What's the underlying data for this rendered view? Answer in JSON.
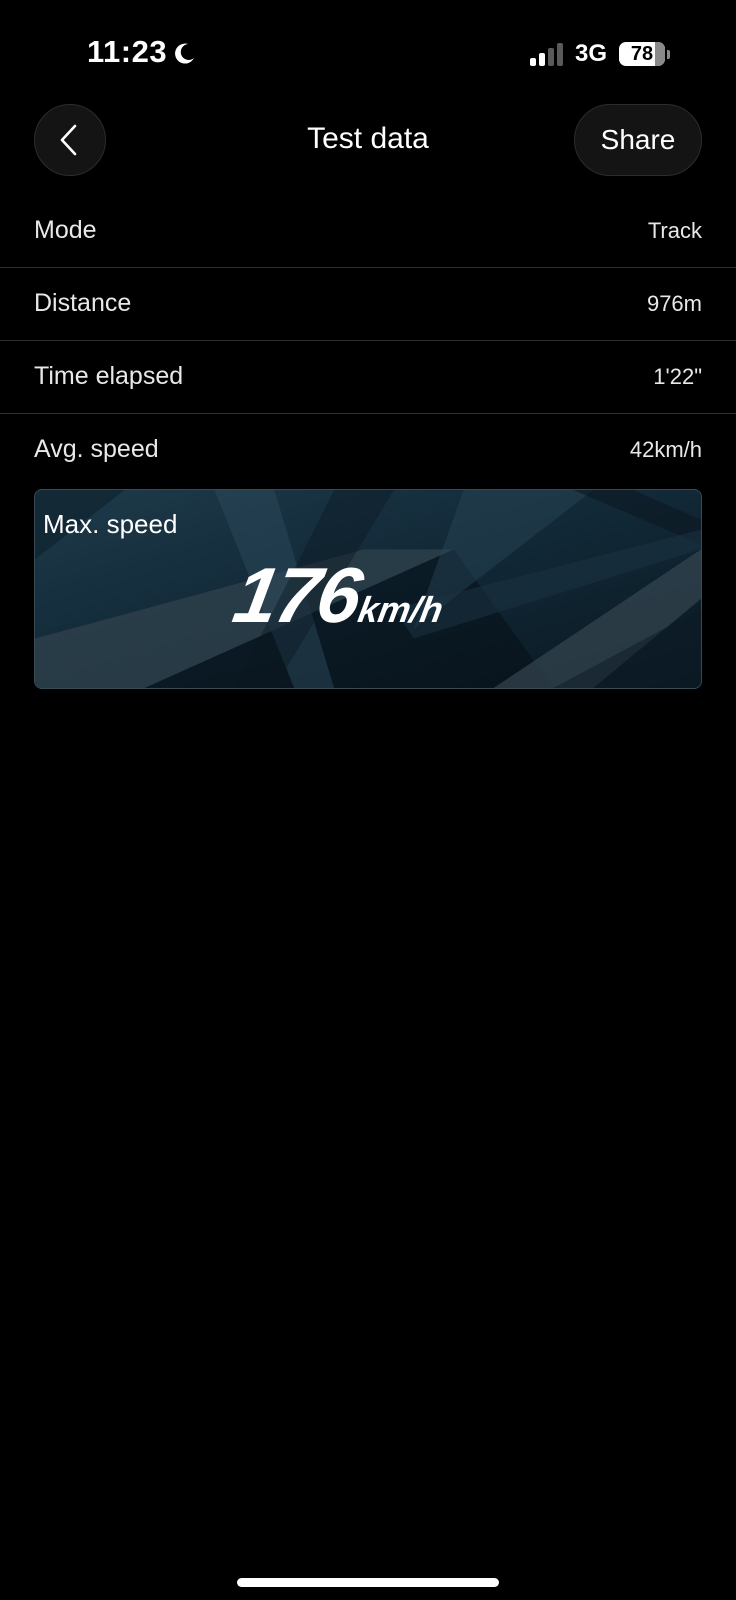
{
  "status_bar": {
    "time": "11:23",
    "network": "3G",
    "battery_level": "78",
    "battery_fraction": 0.78,
    "signal_bars_active": 2,
    "signal_bars_total": 4,
    "icons": [
      "moon-icon",
      "signal-icon",
      "battery-icon"
    ]
  },
  "header": {
    "title": "Test data",
    "back_icon": "chevron-left-icon",
    "share_label": "Share"
  },
  "rows": [
    {
      "label": "Mode",
      "value": "Track"
    },
    {
      "label": "Distance",
      "value": "976m"
    },
    {
      "label": "Time elapsed",
      "value": "1'22\""
    },
    {
      "label": "Avg. speed",
      "value": "42km/h"
    }
  ],
  "max_speed": {
    "label": "Max. speed",
    "value": "176",
    "unit": "km/h"
  },
  "colors": {
    "background": "#000000",
    "card_base": "#0e1c26",
    "divider": "#2e2e2e",
    "text": "#ffffff"
  }
}
